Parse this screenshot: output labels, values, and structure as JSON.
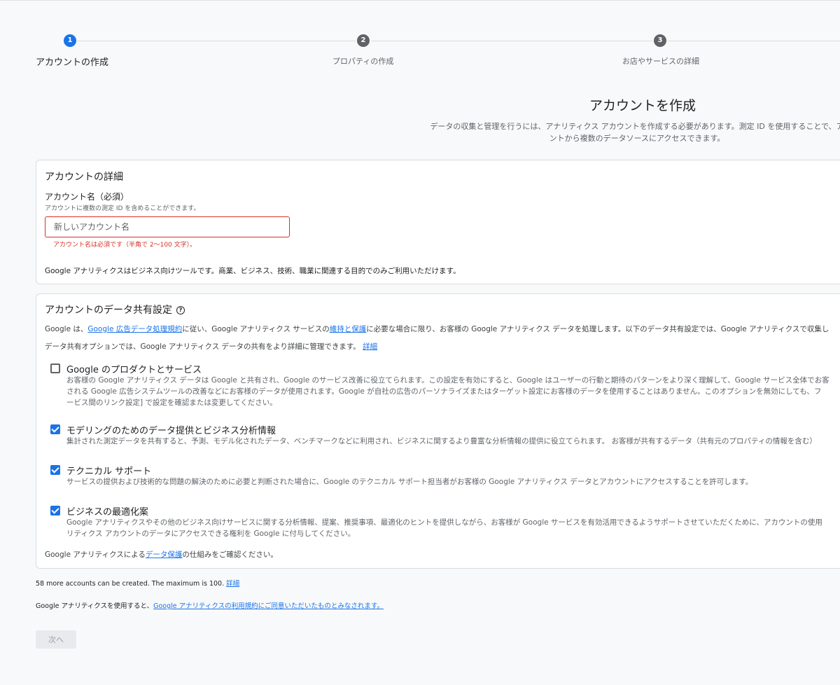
{
  "stepper": {
    "steps": [
      {
        "number": "1",
        "label": "アカウントの作成",
        "state": "active"
      },
      {
        "number": "2",
        "label": "プロパティの作成",
        "state": "inactive"
      },
      {
        "number": "3",
        "label": "お店やサービスの詳細",
        "state": "inactive"
      }
    ]
  },
  "header": {
    "title": "アカウントを作成",
    "description_line1": "データの収集と管理を行うには、アナリティクス アカウントを作成する必要があります。測定 ID を使用することで、ア",
    "description_line2": "ントから複数のデータソースにアクセスできます。"
  },
  "account_details": {
    "title": "アカウントの詳細",
    "name_label": "アカウント名（必須）",
    "name_help": "アカウントに複数の測定 ID を含めることができます。",
    "name_placeholder": "新しいアカウント名",
    "name_value": "",
    "name_error": "アカウント名は必須です（半角で 2〜100 文字）。",
    "note": "Google アナリティクスはビジネス向けツールです。商業、ビジネス、技術、職業に関連する目的でのみご利用いただけます。"
  },
  "data_sharing": {
    "title": "アカウントのデータ共有設定",
    "help_icon": "help-circle-icon",
    "intro_prefix": "Google は、",
    "intro_link1": "Google 広告データ処理規約",
    "intro_middle": "に従い、Google アナリティクス サービスの",
    "intro_link2": "維持と保護",
    "intro_suffix": "に必要な場合に限り、お客様の Google アナリティクス データを処理します。以下のデータ共有設定では、Google アナリティクスで収集し",
    "options_note": "データ共有オプションでは、Google アナリティクス データの共有をより詳細に管理できます。",
    "options_note_link": "詳細",
    "options": [
      {
        "title": "Google のプロダクトとサービス",
        "checked": false,
        "desc": [
          "お客様の Google アナリティクス データは Google と共有され、Google のサービス改善に役立てられます。この設定を有効にすると、Google はユーザーの行動と期待のパターンをより深く理解して、Google サービス全体でお客",
          "される Google 広告システムツールの改善などにお客様のデータが使用されます。Google が自社の広告のパーソナライズまたはターゲット設定にお客様のデータを使用することはありません。このオプションを無効にしても、フ",
          "ービス間のリンク設定] で設定を確認または変更してください。"
        ]
      },
      {
        "title": "モデリングのためのデータ提供とビジネス分析情報",
        "checked": true,
        "desc": [
          "集計された測定データを共有すると、予測、モデル化されたデータ、ベンチマークなどに利用され、ビジネスに関するより豊富な分析情報の提供に役立てられます。 お客様が共有するデータ（共有元のプロパティの情報を含む）"
        ]
      },
      {
        "title": "テクニカル サポート",
        "checked": true,
        "desc": [
          "サービスの提供および技術的な問題の解決のために必要と判断された場合に、Google のテクニカル サポート担当者がお客様の Google アナリティクス データとアカウントにアクセスすることを許可します。"
        ]
      },
      {
        "title": "ビジネスの最適化案",
        "checked": true,
        "desc": [
          "Google アナリティクスやその他のビジネス向けサービスに関する分析情報、提案、推奨事項、最適化のヒントを提供しながら、お客様が Google サービスを有効活用できるようサポートさせていただくために、アカウントの使用",
          "リティクス アカウントのデータにアクセスできる権利を Google に付与してください。"
        ]
      }
    ],
    "footer_prefix": "Google アナリティクスによる",
    "footer_link": "データ保護",
    "footer_suffix": "の仕組みをご確認ください。"
  },
  "accounts_note": {
    "text": "58 more accounts can be created. The maximum is 100.",
    "link": "詳細"
  },
  "terms_note": {
    "prefix": "Google アナリティクスを使用すると、",
    "link": "Google アナリティクスの利用規約にご同意いただいたものとみなされます。"
  },
  "next_button": "次へ",
  "colors": {
    "accent": "#1a73e8",
    "error": "#d93025",
    "inactive_step": "#5f6368"
  }
}
